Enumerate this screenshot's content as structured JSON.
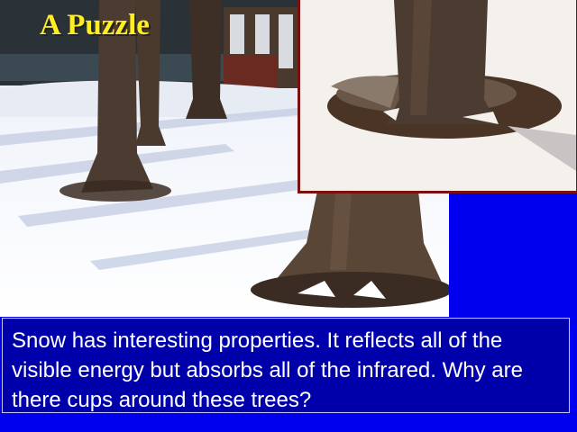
{
  "slide": {
    "title": "A Puzzle",
    "caption": "Snow has interesting properties. It reflects all of the visible energy but absorbs all of the infrared. Why are there cups around these trees?",
    "colors": {
      "background": "#0000ee",
      "caption_box": "#0000aa",
      "title_text": "#ffee22",
      "inset_border": "#7a1010"
    }
  },
  "images": {
    "main_photo": "snowy-park-trees-photo",
    "inset_photo": "tree-trunk-snow-cup-closeup-photo"
  }
}
